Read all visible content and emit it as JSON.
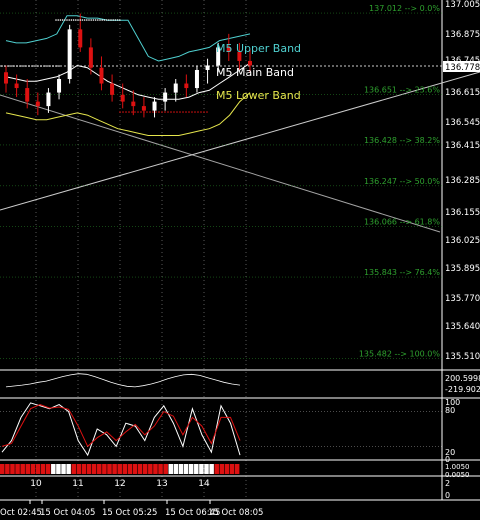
{
  "colors": {
    "background": "#000000",
    "grid": "#ffffff",
    "axis_text": "#ffffff",
    "upper_band": "#4fd0d0",
    "main_band": "#ffffff",
    "lower_band": "#e6e64d",
    "fib": "#2ea02e",
    "bull": "#ffffff",
    "bear": "#dd1111",
    "stoch_k": "#ffffff",
    "stoch_d": "#dd1111",
    "bar_red": "#dd1111",
    "bar_white": "#ffffff",
    "price_box_bg": "#ffffff",
    "price_box_text": "#000000",
    "trend": "#cccccc"
  },
  "chart_data": [
    {
      "type": "candlestick",
      "panel": "main",
      "ylim": [
        135.44,
        137.07
      ],
      "y_ticks": [
        "137.005",
        "136.875",
        "136.745",
        "136.615",
        "136.545",
        "136.415",
        "136.285",
        "136.155",
        "136.025",
        "135.895",
        "135.770",
        "135.640",
        "135.510"
      ],
      "current_price": "136.778",
      "bands": [
        {
          "name": "M5 Upper Band",
          "values": [
            136.89,
            136.88,
            136.88,
            136.89,
            136.9,
            136.92,
            137.0,
            137.0,
            136.99,
            136.99,
            136.98,
            136.98,
            136.98,
            136.9,
            136.82,
            136.8,
            136.81,
            136.82,
            136.84,
            136.85,
            136.86,
            136.89,
            136.9,
            136.91,
            136.92
          ]
        },
        {
          "name": "M5 Main Band",
          "values": [
            136.73,
            136.72,
            136.71,
            136.71,
            136.72,
            136.73,
            136.75,
            136.78,
            136.77,
            136.74,
            136.71,
            136.69,
            136.67,
            136.65,
            136.64,
            136.63,
            136.63,
            136.63,
            136.64,
            136.66,
            136.67,
            136.7,
            136.73,
            136.76,
            136.79
          ]
        },
        {
          "name": "M5 Lower Band",
          "values": [
            136.57,
            136.56,
            136.55,
            136.54,
            136.54,
            136.55,
            136.56,
            136.57,
            136.56,
            136.54,
            136.52,
            136.5,
            136.49,
            136.48,
            136.47,
            136.47,
            136.47,
            136.47,
            136.48,
            136.49,
            136.5,
            136.52,
            136.56,
            136.62,
            136.66
          ]
        }
      ],
      "fib_levels": [
        {
          "price": "137.012",
          "ratio": "0.0%"
        },
        {
          "price": "136.651",
          "ratio": "23.6%"
        },
        {
          "price": "136.428",
          "ratio": "38.2%"
        },
        {
          "price": "136.247",
          "ratio": "50.0%"
        },
        {
          "price": "136.066",
          "ratio": "61.8%"
        },
        {
          "price": "135.843",
          "ratio": "76.4%"
        },
        {
          "price": "135.482",
          "ratio": "100.0%"
        }
      ],
      "candles": [
        [
          136.75,
          136.78,
          136.66,
          136.7
        ],
        [
          136.7,
          136.74,
          136.64,
          136.68
        ],
        [
          136.68,
          136.72,
          136.59,
          136.62
        ],
        [
          136.62,
          136.66,
          136.56,
          136.6
        ],
        [
          136.6,
          136.68,
          136.57,
          136.66
        ],
        [
          136.66,
          136.74,
          136.63,
          136.72
        ],
        [
          136.72,
          136.96,
          136.7,
          136.94
        ],
        [
          136.94,
          137.01,
          136.84,
          136.86
        ],
        [
          136.86,
          136.9,
          136.74,
          136.77
        ],
        [
          136.77,
          136.82,
          136.67,
          136.7
        ],
        [
          136.7,
          136.74,
          136.62,
          136.65
        ],
        [
          136.65,
          136.7,
          136.59,
          136.62
        ],
        [
          136.62,
          136.67,
          136.56,
          136.6
        ],
        [
          136.6,
          136.64,
          136.55,
          136.58
        ],
        [
          136.58,
          136.64,
          136.55,
          136.62
        ],
        [
          136.62,
          136.68,
          136.58,
          136.66
        ],
        [
          136.66,
          136.72,
          136.62,
          136.7
        ],
        [
          136.7,
          136.74,
          136.64,
          136.68
        ],
        [
          136.68,
          136.78,
          136.66,
          136.76
        ],
        [
          136.76,
          136.81,
          136.7,
          136.78
        ],
        [
          136.78,
          136.88,
          136.75,
          136.86
        ],
        [
          136.86,
          136.92,
          136.8,
          136.84
        ],
        [
          136.84,
          136.88,
          136.76,
          136.8
        ],
        [
          136.8,
          136.85,
          136.75,
          136.78
        ]
      ]
    },
    {
      "type": "line",
      "panel": "oscillator",
      "y_ticks": [
        "200.5998",
        "-219.9026"
      ],
      "values": [
        -60,
        -45,
        -30,
        -10,
        20,
        40,
        80,
        120,
        150,
        170,
        160,
        120,
        70,
        20,
        -20,
        -50,
        -60,
        -40,
        -10,
        30,
        80,
        120,
        150,
        160,
        140,
        100,
        60,
        20,
        -10,
        -30
      ]
    },
    {
      "type": "line",
      "panel": "stochastic",
      "y_ticks": [
        "100",
        "80",
        "20",
        "0"
      ],
      "series": [
        {
          "values": [
            10,
            30,
            70,
            95,
            90,
            85,
            92,
            80,
            30,
            5,
            50,
            40,
            20,
            60,
            55,
            30,
            70,
            90,
            60,
            20,
            85,
            40,
            10,
            90,
            60,
            5
          ]
        },
        {
          "values": [
            20,
            25,
            55,
            85,
            92,
            86,
            88,
            84,
            55,
            20,
            35,
            45,
            30,
            45,
            58,
            40,
            55,
            80,
            72,
            40,
            70,
            55,
            25,
            70,
            70,
            30
          ]
        }
      ]
    },
    {
      "type": "bar",
      "panel": "signal-strip",
      "blocks": [
        [
          "red",
          10
        ],
        [
          "white",
          4
        ],
        [
          "red",
          19
        ],
        [
          "white",
          9
        ],
        [
          "red",
          5
        ]
      ],
      "y_ticks": [
        "1.0050",
        "0.0050"
      ]
    },
    {
      "type": "bar",
      "panel": "lower-panel",
      "y_ticks": [
        "2",
        "0"
      ]
    }
  ],
  "x_axis": {
    "day_labels": [
      "10",
      "11",
      "12",
      "13",
      "14"
    ],
    "time_labels": [
      "Oct 02:45",
      "15 Oct 04:05",
      "15 Oct 05:25",
      "15 Oct 06:45",
      "15 Oct 08:05"
    ]
  }
}
